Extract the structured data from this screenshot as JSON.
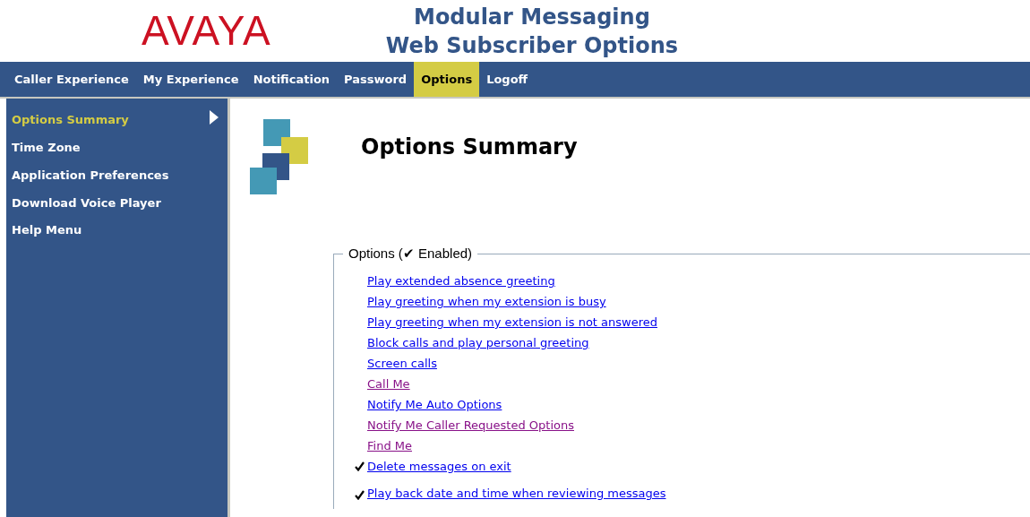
{
  "header": {
    "logo": "AVAYA",
    "title_lines": [
      "Modular Messaging",
      "Web Subscriber Options"
    ]
  },
  "nav_tabs": [
    {
      "label": "Caller Experience",
      "selected": false
    },
    {
      "label": "My Experience",
      "selected": false
    },
    {
      "label": "Notification",
      "selected": false
    },
    {
      "label": "Password",
      "selected": false
    },
    {
      "label": "Options",
      "selected": true
    },
    {
      "label": "Logoff",
      "selected": false
    }
  ],
  "sidebar": {
    "items": [
      {
        "label": "Options Summary",
        "selected": true
      },
      {
        "label": "Time Zone",
        "selected": false
      },
      {
        "label": "Application Preferences",
        "selected": false
      },
      {
        "label": "Download Voice Player",
        "selected": false
      },
      {
        "label": "Help Menu",
        "selected": false
      }
    ]
  },
  "page_title": "Options Summary",
  "options_group": {
    "legend": "Options (✔ Enabled)",
    "items": [
      {
        "label": "Play extended absence greeting",
        "enabled": false,
        "visited": false
      },
      {
        "label": "Play greeting when my extension is busy",
        "enabled": false,
        "visited": false
      },
      {
        "label": "Play greeting when my extension is not answered",
        "enabled": false,
        "visited": false
      },
      {
        "label": "Block calls and play personal greeting",
        "enabled": false,
        "visited": false
      },
      {
        "label": "Screen calls",
        "enabled": false,
        "visited": false
      },
      {
        "label": "Call Me",
        "enabled": false,
        "visited": true
      },
      {
        "label": "Notify Me Auto Options",
        "enabled": false,
        "visited": false
      },
      {
        "label": "Notify Me Caller Requested Options",
        "enabled": false,
        "visited": true
      },
      {
        "label": "Find Me",
        "enabled": false,
        "visited": true
      },
      {
        "label": "Delete messages on exit",
        "enabled": true,
        "visited": false
      },
      {
        "label": "Play back date and time when reviewing messages",
        "enabled": true,
        "visited": false
      }
    ]
  }
}
